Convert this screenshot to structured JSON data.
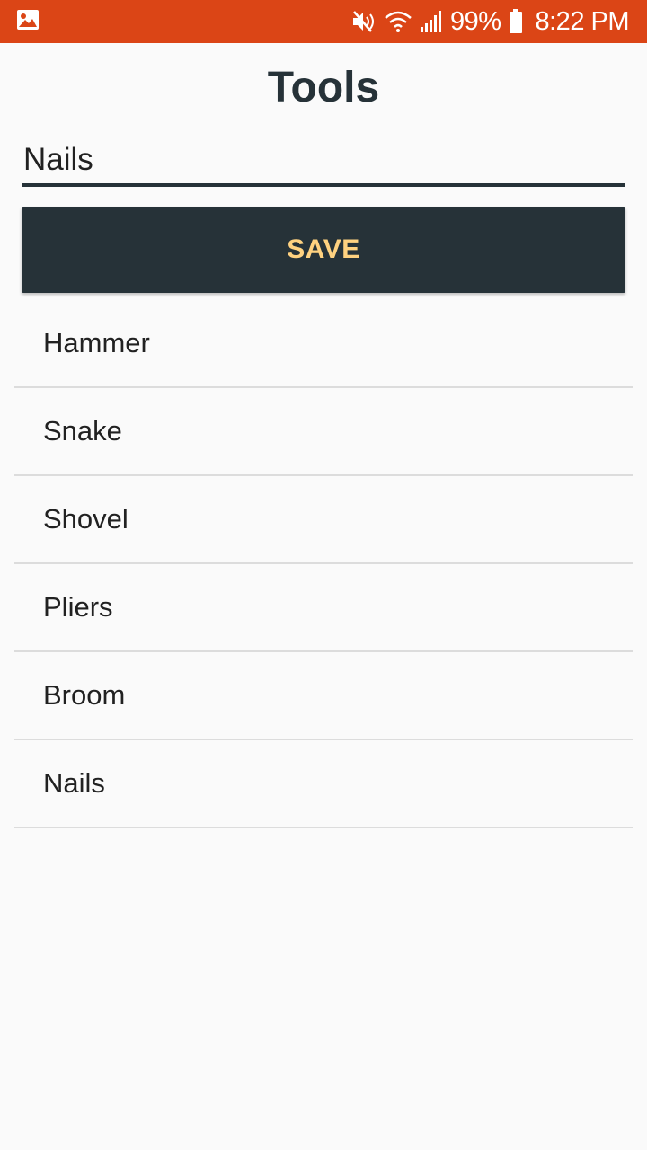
{
  "status_bar": {
    "battery": "99%",
    "time": "8:22 PM",
    "icons": [
      "image-icon",
      "mute-icon",
      "wifi-icon",
      "signal-icon",
      "battery-icon"
    ],
    "color": "#db4516"
  },
  "header": {
    "title": "Tools"
  },
  "input": {
    "value": "Nails",
    "placeholder": ""
  },
  "save_button": {
    "label": "SAVE",
    "background": "#263238",
    "text_color": "#ffd280"
  },
  "items": [
    {
      "label": "Hammer"
    },
    {
      "label": "Snake"
    },
    {
      "label": "Shovel"
    },
    {
      "label": "Pliers"
    },
    {
      "label": "Broom"
    },
    {
      "label": "Nails"
    }
  ]
}
